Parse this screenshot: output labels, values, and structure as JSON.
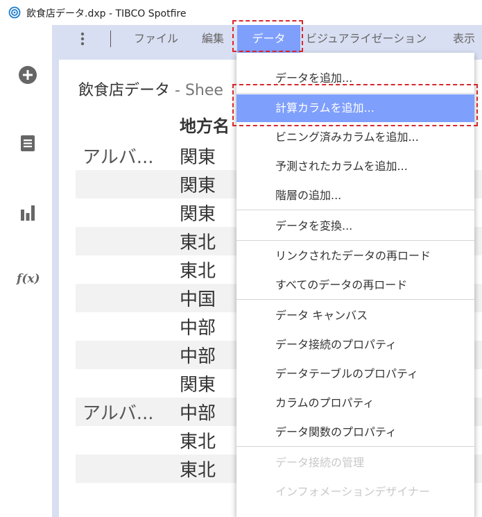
{
  "window": {
    "title": "飲食店データ.dxp - TIBCO Spotfire"
  },
  "menubar": {
    "items": [
      {
        "label": "ファイル"
      },
      {
        "label": "編集"
      },
      {
        "label": "データ",
        "active": true
      },
      {
        "label": "ビジュアライゼーション"
      },
      {
        "label": "表示"
      }
    ]
  },
  "rail": {
    "icons": [
      "add-icon",
      "data-table-icon",
      "bar-chart-icon",
      "function-icon"
    ],
    "function_label": "f(x)"
  },
  "visualization": {
    "title": "飲食店データ",
    "title_suffix": " - Shee",
    "column_header": "地方名",
    "rows": [
      {
        "c1": "アルバ...",
        "c2": "関東"
      },
      {
        "c1": "",
        "c2": "関東"
      },
      {
        "c1": "",
        "c2": "関東"
      },
      {
        "c1": "",
        "c2": "東北"
      },
      {
        "c1": "",
        "c2": "東北"
      },
      {
        "c1": "",
        "c2": "中国"
      },
      {
        "c1": "",
        "c2": "中部"
      },
      {
        "c1": "",
        "c2": "中部"
      },
      {
        "c1": "",
        "c2": "関東"
      },
      {
        "c1": "アルバ...",
        "c2": "中部"
      },
      {
        "c1": "",
        "c2": "東北"
      },
      {
        "c1": "",
        "c2": "東北"
      }
    ]
  },
  "dropdown": {
    "items": [
      {
        "label": "データを追加..."
      },
      {
        "label": "計算カラムを追加...",
        "highlight": true
      },
      {
        "label": "ビニング済みカラムを追加..."
      },
      {
        "label": "予測されたカラムを追加..."
      },
      {
        "label": "階層の追加..."
      },
      {
        "label": "データを変換..."
      },
      {
        "label": "リンクされたデータの再ロード"
      },
      {
        "label": "すべてのデータの再ロード"
      },
      {
        "label": "データ キャンバス"
      },
      {
        "label": "データ接続のプロパティ"
      },
      {
        "label": "データテーブルのプロパティ"
      },
      {
        "label": "カラムのプロパティ"
      },
      {
        "label": "データ関数のプロパティ"
      },
      {
        "label": "データ接続の管理",
        "disabled": true
      },
      {
        "label": "インフォメーションデザイナー",
        "disabled": true
      }
    ]
  },
  "colors": {
    "accent": "#7f9ffc",
    "menubar_bg": "#d9dff2",
    "annotation": "#d9262a"
  }
}
